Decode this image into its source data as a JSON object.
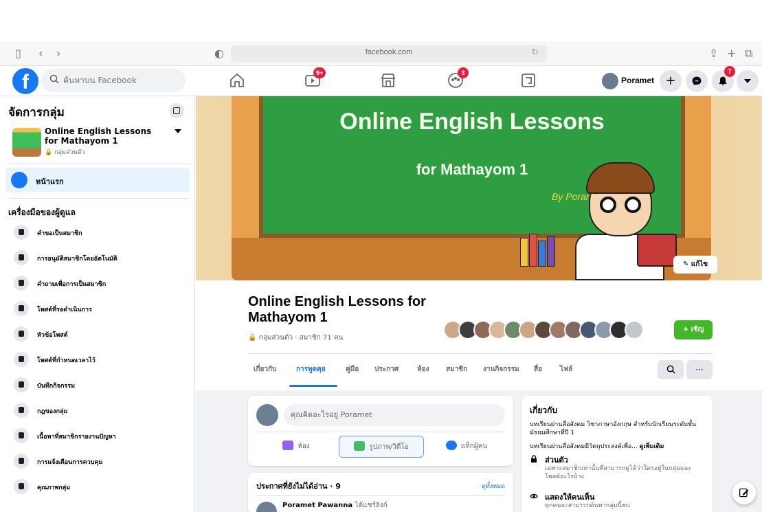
{
  "browser": {
    "url": "facebook.com"
  },
  "header": {
    "search_placeholder": "ค้นหาบน Facebook",
    "profile_name": "Poramet",
    "watch_badge": "9+",
    "groups_badge": "3",
    "notifications_badge": "7"
  },
  "sidebar": {
    "title": "จัดการกลุ่ม",
    "group_name": "Online English Lessons for Mathayom 1",
    "group_privacy": "กลุ่มส่วนตัว",
    "home_label": "หน้าแรก",
    "admin_tools_title": "เครื่องมือของผู้ดูแล",
    "items": [
      {
        "label": "คำขอเป็นสมาชิก",
        "icon": "member-request-icon"
      },
      {
        "label": "การอนุมัติสมาชิกโดยอัตโนมัติ",
        "icon": "auto-approve-icon"
      },
      {
        "label": "คำถามเพื่อการเป็นสมาชิก",
        "icon": "membership-questions-icon"
      },
      {
        "label": "โพสต์ที่รอดำเนินการ",
        "icon": "pending-posts-icon"
      },
      {
        "label": "หัวข้อโพสต์",
        "icon": "post-topics-icon"
      },
      {
        "label": "โพสต์ที่กำหนดเวลาไว้",
        "icon": "scheduled-posts-icon"
      },
      {
        "label": "บันทึกกิจกรรม",
        "icon": "activity-log-icon"
      },
      {
        "label": "กฎของกลุ่ม",
        "icon": "group-rules-icon"
      },
      {
        "label": "เนื้อหาที่สมาชิกรายงานปัญหา",
        "icon": "reported-content-icon"
      },
      {
        "label": "การแจ้งเตือนการควบคุม",
        "icon": "moderation-alerts-icon"
      },
      {
        "label": "คุณภาพกลุ่ม",
        "icon": "group-quality-icon"
      }
    ]
  },
  "cover": {
    "title_line1": "Online English Lessons",
    "title_line2": "for Mathayom 1",
    "byline": "By Poramet",
    "edit_label": "แก้ไข"
  },
  "group": {
    "name": "Online English Lessons for Mathayom 1",
    "meta": "กลุ่มส่วนตัว · สมาชิก 71 คน",
    "invite_label": "+ เชิญ"
  },
  "tabs": [
    {
      "label": "เกี่ยวกับ"
    },
    {
      "label": "การพูดคุย",
      "active": true
    },
    {
      "label": "คู่มือ"
    },
    {
      "label": "ประกาศ"
    },
    {
      "label": "ห้อง"
    },
    {
      "label": "สมาชิก"
    },
    {
      "label": "งานกิจกรรม"
    },
    {
      "label": "สื่อ"
    },
    {
      "label": "ไฟล์"
    }
  ],
  "composer": {
    "prompt": "คุณคิดอะไรอยู่ Poramet",
    "room_label": "ห้อง",
    "photo_label": "รูปภาพ/วิดีโอ",
    "tag_label": "แท็กผู้คน"
  },
  "announcements": {
    "title": "ประกาศที่ยังไม่ได้อ่าน · 9",
    "see_all": "ดูทั้งหมด",
    "author": "Poramet Pawanna",
    "action": "ได้แชร์ลิงก์"
  },
  "about": {
    "title": "เกี่ยวกับ",
    "description": "บทเรียนผ่านสื่อสังคม วิชาภาษาอังกฤษ สำหรับนักเรียนระดับชั้นมัธยมศึกษาที่ปี 1",
    "description2": "บทเรียนผ่านสื่อสังคมมีวัตถุประสงค์เพื่อ...",
    "see_more": "ดูเพิ่มเติม",
    "private_title": "ส่วนตัว",
    "private_desc": "เฉพาะสมาชิกเท่านั้นที่สามารถดูได้ว่าใครอยู่ในกลุ่มและโพสต์อะไรบ้าง",
    "visible_title": "แสดงให้คนเห็น",
    "visible_desc": "ทุกคนจะสามารถค้นหากลุ่มนี้พบ"
  },
  "colors": {
    "brand": "#1877f2",
    "invite": "#42b72a",
    "badge": "#e41e3f"
  }
}
